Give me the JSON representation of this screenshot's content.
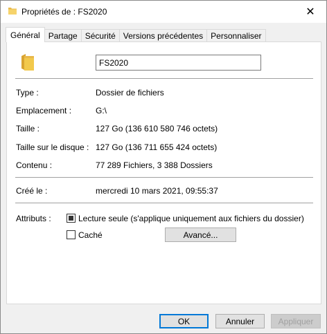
{
  "window": {
    "title": "Propriétés de : FS2020",
    "close_glyph": "✕"
  },
  "tabs": [
    {
      "label": "Général",
      "active": true
    },
    {
      "label": "Partage",
      "active": false
    },
    {
      "label": "Sécurité",
      "active": false
    },
    {
      "label": "Versions précédentes",
      "active": false
    },
    {
      "label": "Personnaliser",
      "active": false
    }
  ],
  "general": {
    "folder_name": "FS2020",
    "folder_icon": "folder-icon",
    "folder_color": "#e8b84b",
    "type_label": "Type :",
    "type_value": "Dossier de fichiers",
    "location_label": "Emplacement :",
    "location_value": "G:\\",
    "size_label": "Taille :",
    "size_value": "127 Go (136 610 580 746 octets)",
    "disk_size_label": "Taille sur le disque :",
    "disk_size_value": "127 Go (136 711 655 424 octets)",
    "contents_label": "Contenu :",
    "contents_value": "77 289 Fichiers, 3 388 Dossiers",
    "created_label": "Créé le :",
    "created_value": "mercredi 10 mars 2021, 09:55:37",
    "attributes_label": "Attributs :",
    "readonly_label": "Lecture seule (s'applique uniquement aux fichiers du dossier)",
    "readonly_state": "indeterminate",
    "hidden_label": "Caché",
    "hidden_state": "unchecked",
    "advanced_label": "Avancé..."
  },
  "footer": {
    "ok_label": "OK",
    "cancel_label": "Annuler",
    "apply_label": "Appliquer"
  }
}
